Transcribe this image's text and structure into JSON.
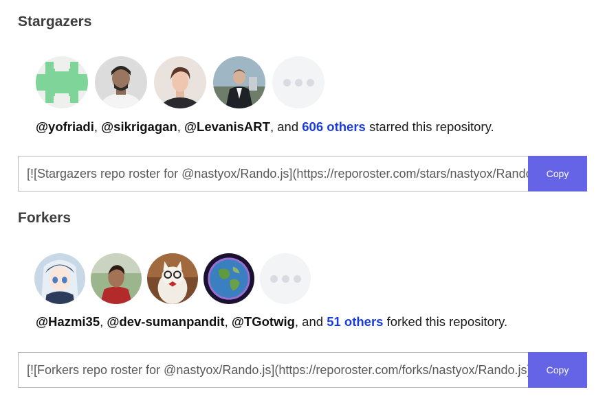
{
  "stargazers": {
    "title": "Stargazers",
    "avatars": [
      {
        "icon": "identicon-avatar",
        "alt": "yofriadi"
      },
      {
        "icon": "photo-avatar",
        "alt": "sikrigagan"
      },
      {
        "icon": "photo-avatar",
        "alt": "LevanisART"
      },
      {
        "icon": "photo-avatar",
        "alt": "user"
      }
    ],
    "users": [
      "@yofriadi",
      "@sikrigagan",
      "@LevanisART"
    ],
    "sep": ", ",
    "and": ", and ",
    "others": "606 others",
    "suffix": " starred this repository.",
    "embed_text": "[![Stargazers repo roster for @nastyox/Rando.js](https://reporoster.com/stars/nastyox/Rando.js)](https://github.com/nastyox/Rando.js/stargazers)",
    "copy_label": "Copy"
  },
  "forkers": {
    "title": "Forkers",
    "avatars": [
      {
        "icon": "anime-avatar",
        "alt": "Hazmi35"
      },
      {
        "icon": "photo-avatar",
        "alt": "dev-sumanpandit"
      },
      {
        "icon": "cat-avatar",
        "alt": "TGotwig"
      },
      {
        "icon": "globe-avatar",
        "alt": "user"
      }
    ],
    "users": [
      "@Hazmi35",
      "@dev-sumanpandit",
      "@TGotwig"
    ],
    "sep": ", ",
    "and": ", and ",
    "others": "51 others",
    "suffix": " forked this repository.",
    "embed_text": "[![Forkers repo roster for @nastyox/Rando.js](https://reporoster.com/forks/nastyox/Rando.js)](https://github.com/nastyox/Rando.js/network/members)",
    "copy_label": "Copy"
  },
  "colors": {
    "accent": "#6563e6",
    "others_link": "#1a3be0"
  }
}
